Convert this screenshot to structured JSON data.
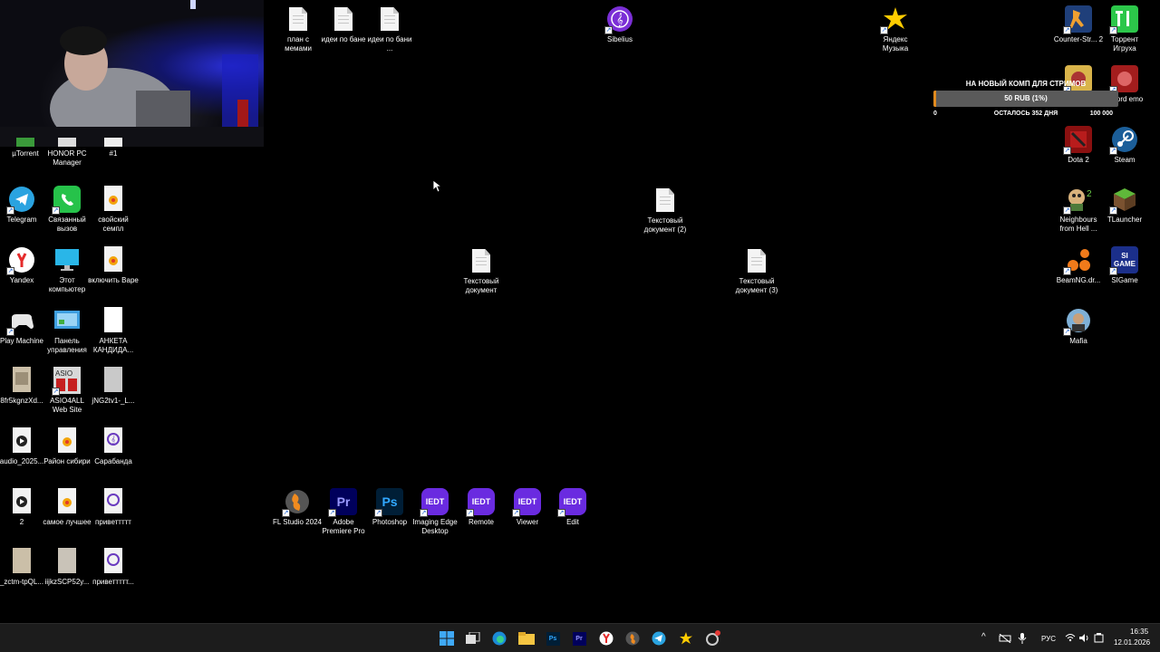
{
  "desktop_icons": {
    "utorrent": "µTorrent",
    "honor": "HONOR PC Manager",
    "num1": "#1",
    "telegram": "Telegram",
    "svyazanny": "Связанный вызов",
    "svoiskii": "свойский семпл",
    "yandex": "Yandex",
    "etot": "Этот компьютер",
    "vklyuchit": "включить Варе",
    "playmachine": "Play Machine",
    "panel": "Панель управления",
    "anketa": "АНКЕТА КАНДИДА...",
    "file8fr": "8fr5kgnzXd...",
    "asio": "ASIO4ALL Web Site",
    "jng": "jNG2tv1-_L...",
    "audio2025": "audio_2025...",
    "raion": "Район сибири",
    "sarabanda": "Сарабанда",
    "file2": "2",
    "samoe": "самое лучшее",
    "privet1": "приветтттт",
    "zctm": "_zctm-tpQL...",
    "iijkz": "iijkzSCP52y...",
    "privet2": "приветтттт...",
    "plan": "план с мемами",
    "idei_bane": "идеи по бане",
    "idei_bani": "идеи по бани ...",
    "sibelius": "Sibelius",
    "yamusic": "Яндекс Музыка",
    "tekst2": "Текстовый документ (2)",
    "tekst": "Текстовый документ",
    "tekst3": "Текстовый документ (3)",
    "flstudio": "FL Studio 2024",
    "premiere": "Adobe Premiere Pro",
    "photoshop": "Photoshop",
    "imaging": "Imaging Edge Desktop",
    "remote": "Remote",
    "viewer": "Viewer",
    "edit": "Edit",
    "counterstrike": "Counter-Str... 2",
    "torrent_igruha": "Торрент Игруха",
    "sword": "Sword emo",
    "dota2": "Dota 2",
    "steam": "Steam",
    "neighbours": "Neighbours from Hell ...",
    "tlauncher": "TLauncher",
    "beamng": "BeamNG.dr...",
    "sigame": "SIGame",
    "mafia": "Mafia",
    "iedt": "IEDT",
    "ps": "Ps",
    "pr": "Pr",
    "si_badge": "SI GAME"
  },
  "donation": {
    "title": "НА НОВЫЙ КОМП ДЛЯ СТРИМОВ",
    "amount_text": "50 RUB (1%)",
    "progress_percent": 1,
    "min_label": "0",
    "days_label": "ОСТАЛОСЬ 352 ДНЯ",
    "max_label": "100 000"
  },
  "taskbar": {
    "lang": "РУС",
    "time": "16:35",
    "date": "12.01.2026"
  },
  "colors": {
    "desktop_bg": "#000000",
    "taskbar_bg": "#1c1c1c",
    "iedt_purple": "#6a2be0",
    "progress_fill": "#e08a1e"
  }
}
